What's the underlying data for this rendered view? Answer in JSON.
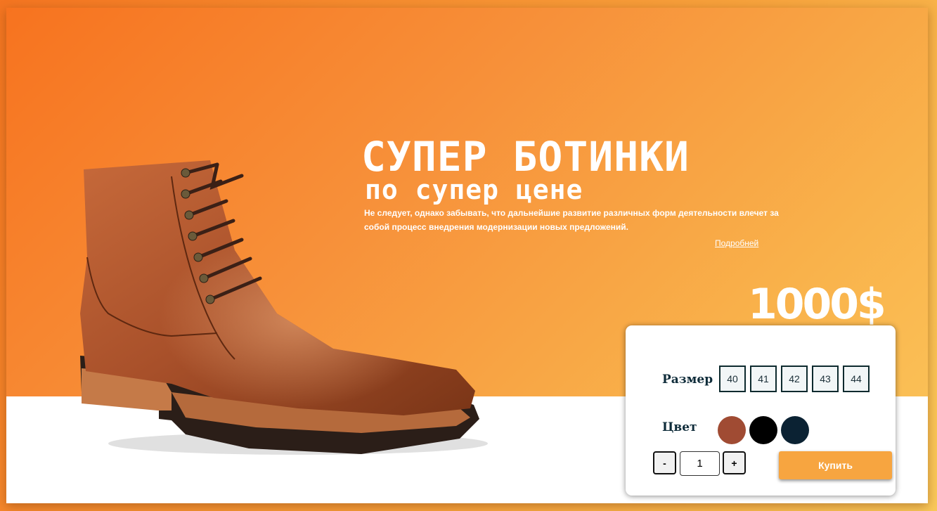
{
  "hero": {
    "headline": "СУПЕР БОТИНКИ",
    "subline": "по супер цене",
    "description": "Не следует, однако забывать, что дальнейшие развитие различных форм деятельности влечет за собой процесс внедрения модернизации новых предложений.",
    "more_link": "Подробней",
    "price": "1000$"
  },
  "product_image": {
    "icon": "leather-boot",
    "color": "#b5582c"
  },
  "options": {
    "size_label": "Размер",
    "sizes": [
      "40",
      "41",
      "42",
      "43",
      "44"
    ],
    "color_label": "Цвет",
    "colors": [
      "#a04b33",
      "#000000",
      "#0b2233"
    ],
    "quantity": {
      "minus": "-",
      "value": "1",
      "plus": "+"
    },
    "buy_label": "Купить"
  },
  "theme": {
    "accent": "#f7a540",
    "gradient_start": "#f7731f",
    "gradient_end": "#fbc55a"
  }
}
